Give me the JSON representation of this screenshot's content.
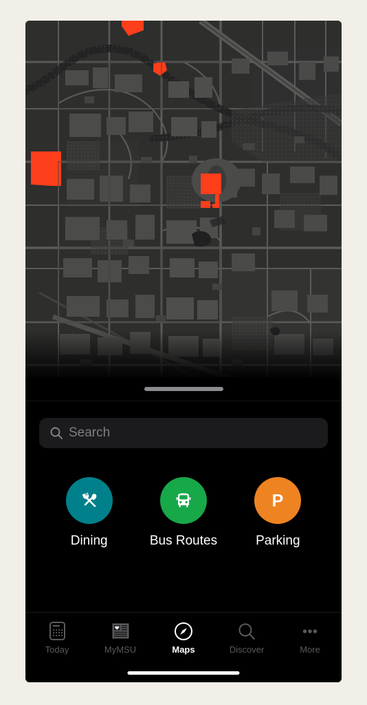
{
  "app": {
    "active_tab": "Maps"
  },
  "map": {
    "style": "dark-campus-map",
    "background_color": "#2e2e2d",
    "building_color": "#474746",
    "road_color": "#5a5a58",
    "water_color": "#232323",
    "highlight_color": "#fc3e1b",
    "highlight_label": "highlighted-campus-parcels"
  },
  "sheet": {
    "grabber": "drag-handle"
  },
  "search": {
    "value": "",
    "placeholder": "Search",
    "icon": "search-icon"
  },
  "shortcuts": [
    {
      "label": "Dining",
      "icon": "fork-and-spoon-icon",
      "color": "#00808a",
      "glyph": "dining"
    },
    {
      "label": "Bus Routes",
      "icon": "bus-icon",
      "color": "#17a84a",
      "glyph": "bus"
    },
    {
      "label": "Parking",
      "icon": "parking-p-icon",
      "color": "#ee8322",
      "glyph": "parking"
    }
  ],
  "tabs": [
    {
      "label": "Today",
      "icon": "today-card-icon",
      "active": false
    },
    {
      "label": "MyMSU",
      "icon": "news-heart-icon",
      "active": false
    },
    {
      "label": "Maps",
      "icon": "compass-icon",
      "active": true
    },
    {
      "label": "Discover",
      "icon": "magnifier-icon",
      "active": false
    },
    {
      "label": "More",
      "icon": "ellipsis-icon",
      "active": false
    }
  ],
  "colors": {
    "page_background": "#f2efe8",
    "sheet_background": "#000000",
    "search_field": "#1b1b1d",
    "tab_inactive": "#5a5a5e",
    "tab_active": "#ffffff",
    "grabber": "#8c8c90"
  }
}
